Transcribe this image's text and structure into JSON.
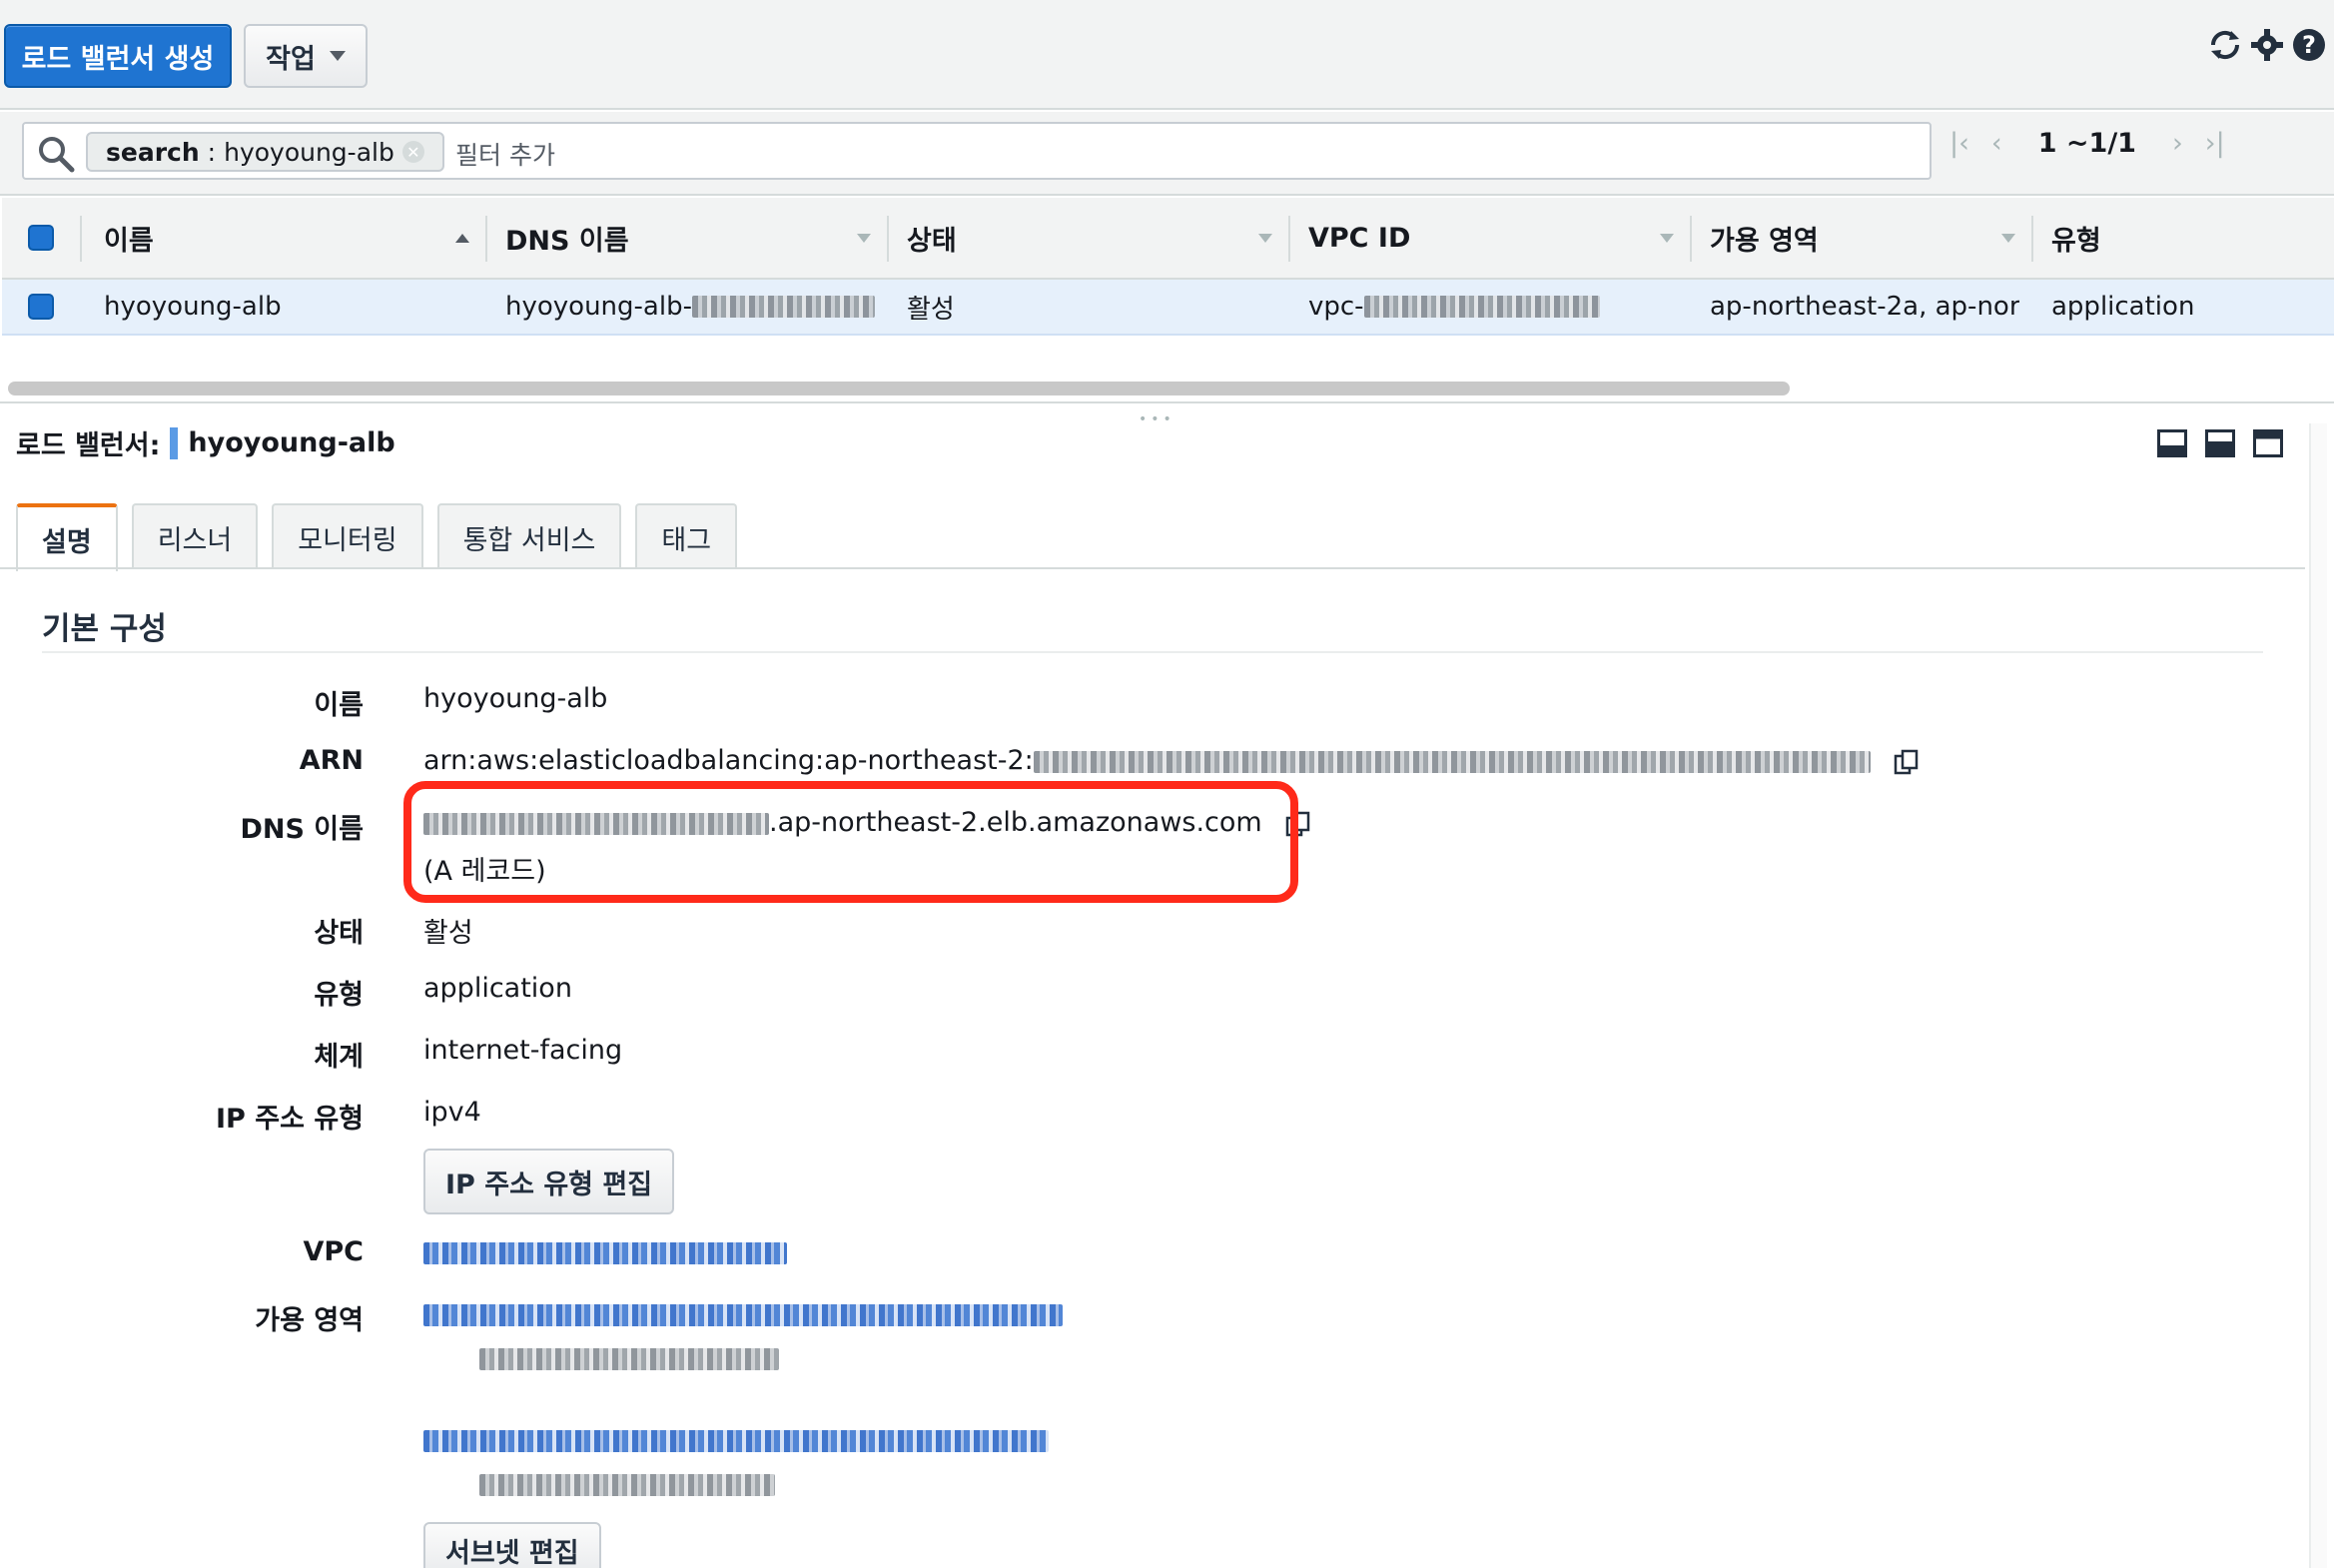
{
  "toolbar": {
    "create_button": "로드 밸런서 생성",
    "actions_button": "작업"
  },
  "filter": {
    "token_key": "search",
    "token_value": "hyoyoung-alb",
    "placeholder": "필터 추가",
    "pager_range": "1 ~1/1"
  },
  "table": {
    "columns": [
      "이름",
      "DNS 이름",
      "상태",
      "VPC ID",
      "가용 영역",
      "유형"
    ],
    "rows": [
      {
        "name": "hyoyoung-alb",
        "dns_prefix": "hyoyoung-alb-",
        "state": "활성",
        "vpc_prefix": "vpc-",
        "az": "ap-northeast-2a, ap-nor…",
        "type": "application"
      }
    ]
  },
  "detail": {
    "title_label": "로드 밸런서:",
    "title_value": "hyoyoung-alb",
    "tabs": [
      "설명",
      "리스너",
      "모니터링",
      "통합 서비스",
      "태그"
    ],
    "section_title": "기본 구성",
    "fields": {
      "name_label": "이름",
      "name_value": "hyoyoung-alb",
      "arn_label": "ARN",
      "arn_prefix": "arn:aws:elasticloadbalancing:ap-northeast-2:",
      "dns_label": "DNS 이름",
      "dns_suffix": ".ap-northeast-2.elb.amazonaws.com",
      "dns_record": "(A 레코드)",
      "state_label": "상태",
      "state_value": "활성",
      "type_label": "유형",
      "type_value": "application",
      "scheme_label": "체계",
      "scheme_value": "internet-facing",
      "ip_type_label": "IP 주소 유형",
      "ip_type_value": "ipv4",
      "edit_ip_button": "IP 주소 유형 편집",
      "vpc_label": "VPC",
      "az_label": "가용 영역",
      "edit_subnet_button": "서브넷 편집"
    }
  },
  "colors": {
    "primary": "#1f74d1",
    "highlight": "#ff2a1a",
    "active_tab_accent": "#ec7211"
  }
}
